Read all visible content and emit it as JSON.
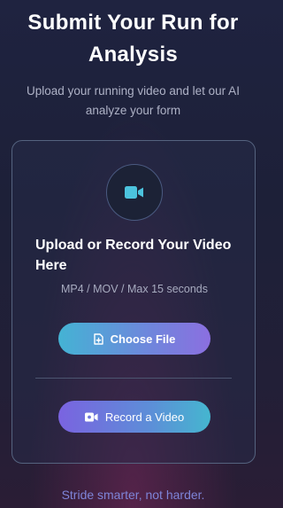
{
  "header": {
    "title": "Submit Your Run for Analysis",
    "subtitle": "Upload your running video and let our AI analyze your form"
  },
  "upload_card": {
    "icon": "video-camera-icon",
    "title": "Upload or Record Your Video Here",
    "formats": "MP4 / MOV / Max 15 seconds",
    "choose_button": {
      "label": "Choose File",
      "icon": "file-plus-icon"
    },
    "record_button": {
      "label": "Record a Video",
      "icon": "video-record-icon"
    }
  },
  "footer": {
    "tagline": "Stride smarter, not harder."
  },
  "colors": {
    "accent_cyan": "#44b3d4",
    "accent_purple": "#7a63e0",
    "tagline": "#7e84d8"
  }
}
